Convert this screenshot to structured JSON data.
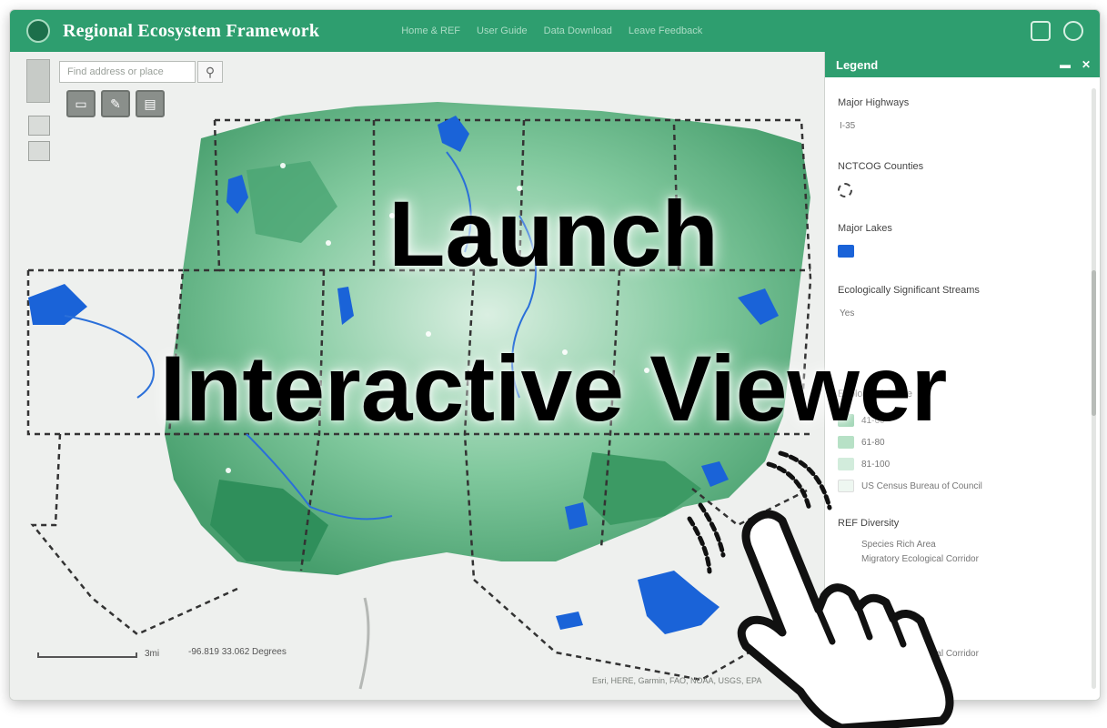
{
  "app": {
    "title": "Regional Ecosystem Framework",
    "nav": [
      "Home & REF",
      "User Guide",
      "Data Download",
      "Leave Feedback"
    ]
  },
  "search": {
    "placeholder": "Find address or place"
  },
  "map": {
    "scale_label": "3mi",
    "coords": "-96.819  33.062 Degrees",
    "attribution": "Esri, HERE, Garmin, FAO, NOAA, USGS, EPA"
  },
  "legend": {
    "title": "Legend",
    "sections": [
      {
        "title": "Major Highways",
        "items": [
          "I-35"
        ]
      },
      {
        "title": "NCTCOG Counties",
        "items": []
      },
      {
        "title": "Major Lakes",
        "items": []
      },
      {
        "title": "Ecologically Significant Streams",
        "items": [
          "Yes"
        ]
      },
      {
        "title": "Ecological Score",
        "items": [
          "41-60",
          "61-80",
          "81-100",
          "US Census Bureau of Council"
        ]
      },
      {
        "title": "REF Diversity",
        "items": [
          "Species Rich Area",
          "Migratory Ecological Corridor"
        ]
      },
      {
        "title": "",
        "items": [
          "Migratory Ecological Corridor"
        ]
      }
    ]
  },
  "overlay": {
    "line1": "Launch",
    "line2": "Interactive Viewer"
  },
  "colors": {
    "header": "#2e9e6f",
    "map_green_dark": "#2f8f5b",
    "map_green_light": "#c9e8d5",
    "water": "#1a63d8"
  }
}
